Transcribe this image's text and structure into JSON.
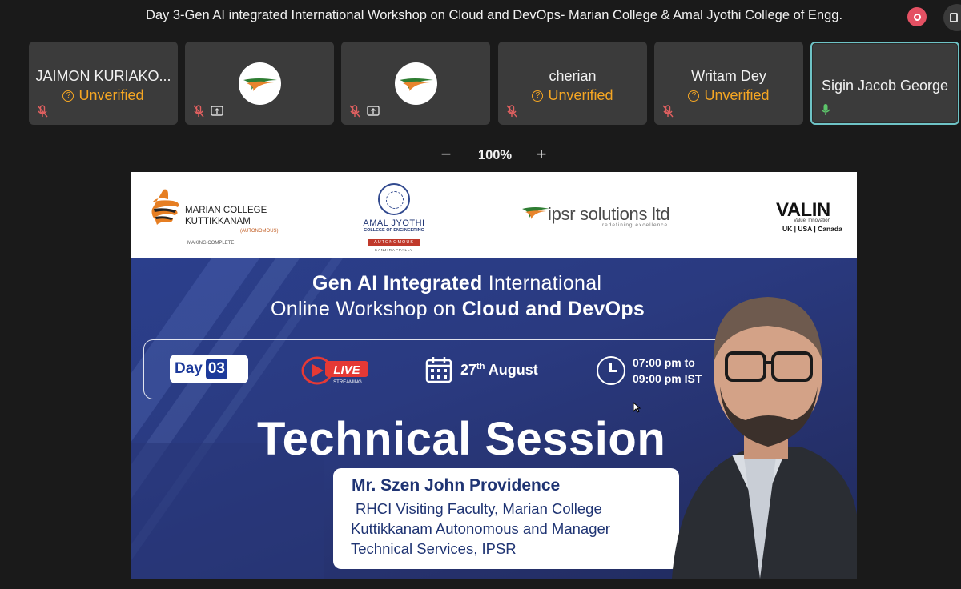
{
  "meeting": {
    "title": "Day 3-Gen AI integrated International Workshop on Cloud and DevOps- Marian College & Amal Jyothi College of Engg."
  },
  "participants": [
    {
      "name": "JAIMON KURIAKO...",
      "status": "Unverified",
      "mic": "muted"
    },
    {
      "name": "",
      "status": "",
      "mic": "muted",
      "sharing": true,
      "avatar": "ipsr-logo"
    },
    {
      "name": "",
      "status": "",
      "mic": "muted",
      "sharing": true,
      "avatar": "ipsr-logo"
    },
    {
      "name": "cherian",
      "status": "Unverified",
      "mic": "muted"
    },
    {
      "name": "Writam Dey",
      "status": "Unverified",
      "mic": "muted"
    },
    {
      "name": "Sigin Jacob George",
      "status": "",
      "mic": "active",
      "speaking": true
    }
  ],
  "zoom": {
    "level": "100%",
    "minus": "−",
    "plus": "+"
  },
  "slide": {
    "logos": {
      "marian": {
        "line1": "MARIAN COLLEGE",
        "line2": "KUTTIKKANAM",
        "line3": "(AUTONOMOUS)",
        "line4": "MAKING COMPLETE"
      },
      "amal": {
        "line1": "AMAL JYOTHI",
        "line2": "COLLEGE OF ENGINEERING",
        "line3": "AUTONOMOUS",
        "line4": "KANJIRAPPALLY"
      },
      "ipsr": {
        "name": "ipsr solutions ltd",
        "tagline": "redefining excellence"
      },
      "valin": {
        "name": "VALIN",
        "tagline": "Value, Innovation",
        "regions": "UK | USA | Canada"
      }
    },
    "headline_bold_1": "Gen AI Integrated",
    "headline_light_1": " International",
    "headline_light_2": "Online Workshop on ",
    "headline_bold_2": "Cloud and DevOps",
    "day_label": "Day",
    "day_number": "03",
    "live_label": "LIVE",
    "live_sub": "STREAMING",
    "date_day": "27",
    "date_suffix": "th",
    "date_month": " August",
    "time_line1": "07:00 pm to",
    "time_line2": "09:00 pm IST",
    "session_title": "Technical Session",
    "speaker_name": "Mr. Szen John Providence",
    "speaker_bio": [
      "RHCI Visiting Faculty, Marian College",
      "Kuttikkanam Autonomous and Manager",
      "Technical Services, IPSR"
    ]
  },
  "colors": {
    "accent_unverified": "#f5a623",
    "active_tile_border": "#6ec3c6",
    "record": "#e45163",
    "banner_blue": "#2b3f8c"
  }
}
